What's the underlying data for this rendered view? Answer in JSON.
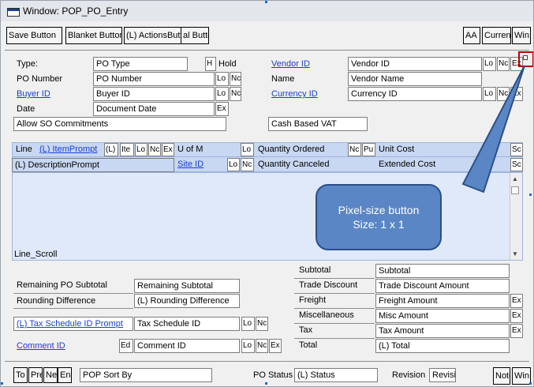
{
  "window": {
    "title": "Window: POP_PO_Entry"
  },
  "toolbar": {
    "save": "Save Button",
    "blanket": "Blanket Button",
    "actions": "(L) ActionsButton",
    "al": "al Butto",
    "aa": "AA I",
    "currency": "Curren",
    "win": "Win"
  },
  "header": {
    "type_label": "Type:",
    "type_value": "PO Type",
    "h": "H",
    "hold": "Hold",
    "po_number_label": "PO Number",
    "po_number_value": "PO Number",
    "buyer_label": "Buyer ID",
    "buyer_value": "Buyer ID",
    "date_label": "Date",
    "date_value": "Document Date",
    "allow_so": "Allow SO Commitments",
    "vendor_label": "Vendor ID",
    "vendor_value": "Vendor ID",
    "name_label": "Name",
    "name_value": "Vendor Name",
    "currency_label": "Currency ID",
    "currency_value": "Currency ID",
    "cash_vat": "Cash Based VAT",
    "lo": "Lo",
    "nc": "Nc",
    "ex": "Ex"
  },
  "grid": {
    "line": "Line",
    "item_prompt": "(L) ItemPrompt",
    "l_col": "(L)",
    "ite": "Ite",
    "lo": "Lo",
    "nc": "Nc",
    "ex": "Ex",
    "uofm": "U of M",
    "qty_ordered": "Quantity Ordered",
    "pu": "Pu",
    "unit_cost": "Unit Cost",
    "sc": "Sc",
    "desc_prompt": "(L) DescriptionPrompt",
    "site_id": "Site ID",
    "qty_canceled": "Quantity Canceled",
    "extended_cost": "Extended Cost",
    "line_scroll": "Line_Scroll"
  },
  "callout": {
    "line1": "Pixel-size button",
    "line2": "Size: 1 x 1"
  },
  "totals_left": {
    "remaining_label": "Remaining PO Subtotal",
    "remaining_value": "Remaining Subtotal",
    "rounding_label": "Rounding Difference",
    "rounding_value": "(L) Rounding Difference",
    "tax_schedule_label": "(L) Tax Schedule ID Prompt",
    "tax_schedule_value": "Tax Schedule ID",
    "comment_label": "Comment ID",
    "comment_value": "Comment ID",
    "ed": "Ed"
  },
  "totals_right": {
    "subtotal_label": "Subtotal",
    "subtotal_value": "Subtotal",
    "trade_label": "Trade Discount",
    "trade_value": "Trade Discount Amount",
    "freight_label": "Freight",
    "freight_value": "Freight Amount",
    "misc_label": "Miscellaneous",
    "misc_value": "Misc Amount",
    "tax_label": "Tax",
    "tax_value": "Tax Amount",
    "total_label": "Total",
    "total_value": "(L) Total",
    "ex": "Ex"
  },
  "footer": {
    "to": "To",
    "pre": "Pre",
    "ne": "Ne",
    "en": "En",
    "sort_by": "POP Sort By",
    "po_status_label": "PO Status",
    "po_status_value": "(L) Status",
    "revision_label": "Revision",
    "revision_value": "Revisi",
    "note": "Note",
    "win": "Win"
  },
  "colors": {
    "accent": "#c00000",
    "grid_header": "#c8d7f2",
    "callout": "#5a86c5",
    "link": "#1a3fcc"
  }
}
